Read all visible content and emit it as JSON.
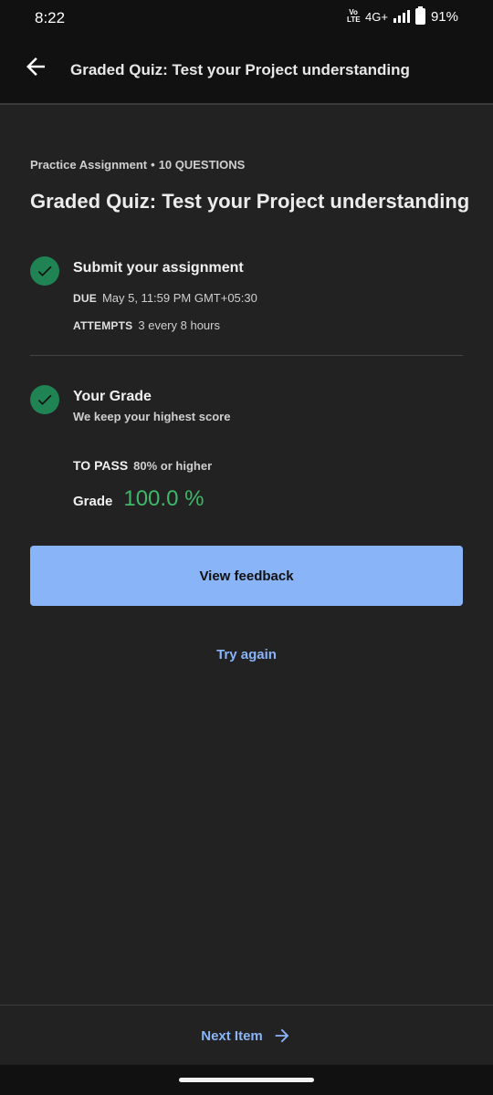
{
  "status_bar": {
    "time": "8:22",
    "volte": "Vo\nLTE",
    "network": "4G+",
    "battery": "91%"
  },
  "app_bar": {
    "back_icon": "arrow-back-icon",
    "title": "Graded Quiz: Test your Project understanding"
  },
  "header": {
    "type": "Practice Assignment",
    "separator": "•",
    "questions": "10 QUESTIONS",
    "title": "Graded Quiz: Test your Project understanding"
  },
  "submit": {
    "icon": "check-circle-icon",
    "title": "Submit your assignment",
    "due_label": "DUE",
    "due_value": "May 5, 11:59 PM GMT+05:30",
    "attempts_label": "ATTEMPTS",
    "attempts_value": "3 every 8 hours"
  },
  "grade": {
    "icon": "check-circle-icon",
    "title": "Your Grade",
    "subtitle": "We keep your highest score",
    "pass_label": "TO PASS",
    "pass_value": "80% or higher",
    "grade_label": "Grade",
    "grade_value": "100.0 %"
  },
  "actions": {
    "view_feedback": "View feedback",
    "try_again": "Try again"
  },
  "bottom": {
    "next_item": "Next Item",
    "next_icon": "arrow-forward-icon"
  },
  "colors": {
    "background": "#222222",
    "accent": "#8ab4f8",
    "success": "#1f8354",
    "grade_text": "#3fb86a"
  }
}
